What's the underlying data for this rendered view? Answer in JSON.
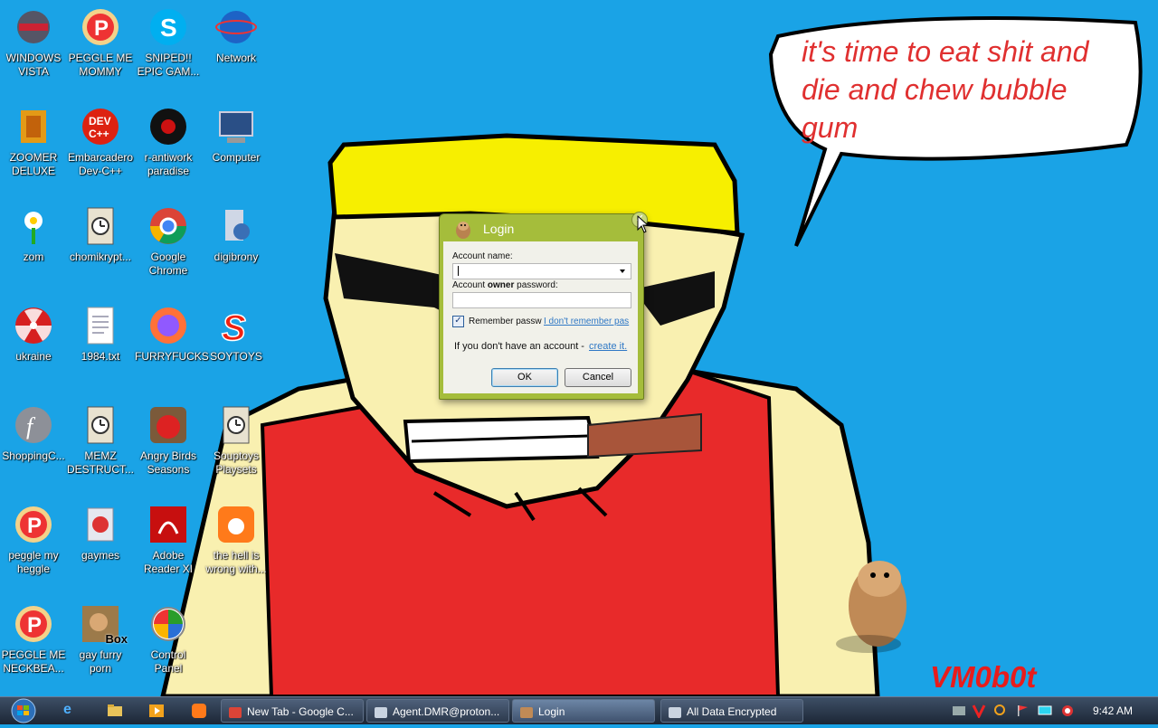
{
  "desktop": {
    "icons": [
      {
        "label": "WINDOWS\nVISTA",
        "icon": "helmet-icon"
      },
      {
        "label": "PEGGLE ME\nMOMMY",
        "icon": "peggle-icon"
      },
      {
        "label": "SNIPED!!\nEPIC GAM...",
        "icon": "skype-icon"
      },
      {
        "label": "Network",
        "icon": "network-icon"
      },
      {
        "label": "ZOOMER\nDELUXE",
        "icon": "zoomer-icon"
      },
      {
        "label": "Embarcadero\nDev-C++",
        "icon": "devcpp-icon"
      },
      {
        "label": "r-antiwork\nparadise",
        "icon": "antiwork-icon"
      },
      {
        "label": "Computer",
        "icon": "computer-icon"
      },
      {
        "label": "zom",
        "icon": "flower-icon"
      },
      {
        "label": "chomikrypt...",
        "icon": "clock-file-icon"
      },
      {
        "label": "Google\nChrome",
        "icon": "chrome-icon"
      },
      {
        "label": "digibrony",
        "icon": "user-icon"
      },
      {
        "label": "ukraine",
        "icon": "radiation-icon"
      },
      {
        "label": "1984.txt",
        "icon": "text-file-icon"
      },
      {
        "label": "FURRYFUCKS",
        "icon": "firefox-icon"
      },
      {
        "label": "SOYTOYS",
        "icon": "soytoys-icon"
      },
      {
        "label": "ShoppingC...",
        "icon": "flash-icon"
      },
      {
        "label": "MEMZ\nDESTRUCT...",
        "icon": "clock-file-icon"
      },
      {
        "label": "Angry Birds\nSeasons",
        "icon": "angry-birds-icon"
      },
      {
        "label": "Souptoys\nPlaysets",
        "icon": "clock-file-icon"
      },
      {
        "label": "peggle my\nheggle",
        "icon": "peggle-icon"
      },
      {
        "label": "gaymes",
        "icon": "games-icon"
      },
      {
        "label": "Adobe\nReader XI",
        "icon": "adobe-reader-icon"
      },
      {
        "label": "the hell is\nwrong with...",
        "icon": "uc-browser-icon"
      },
      {
        "label": "PEGGLE ME\nNECKBEA...",
        "icon": "peggle-icon"
      },
      {
        "label": "gay furry\nporn",
        "icon": "box-icon"
      },
      {
        "label": "Control\nPanel",
        "icon": "control-panel-icon"
      }
    ],
    "box_badge": "Box",
    "bubble_text": "it's time to eat shit and die and chew bubble gum",
    "signature": "VM0b0t"
  },
  "login_dialog": {
    "title": "Login",
    "account_name_label": "Account name:",
    "password_label_prefix": "Account ",
    "password_label_bold": "owner",
    "password_label_suffix": " password:",
    "remember_label": "Remember passw",
    "remember_checked": true,
    "forgot_link": "I don't remember pas",
    "no_account_text": "If you don't have an account - ",
    "create_link": "create it.",
    "ok_label": "OK",
    "cancel_label": "Cancel"
  },
  "taskbar": {
    "tasks": [
      {
        "label": "New Tab - Google C...",
        "icon": "chrome-icon"
      },
      {
        "label": "Agent.DMR@proton...",
        "icon": "window-icon"
      },
      {
        "label": "Login",
        "icon": "hamster-icon"
      },
      {
        "label": "All Data Encrypted",
        "icon": "window-icon"
      }
    ],
    "clock": "9:42 AM"
  },
  "colors": {
    "desktop_blue": "#1aa3e6",
    "dialog_frame": "#a5bd3b",
    "bubble_text": "#e03030"
  }
}
